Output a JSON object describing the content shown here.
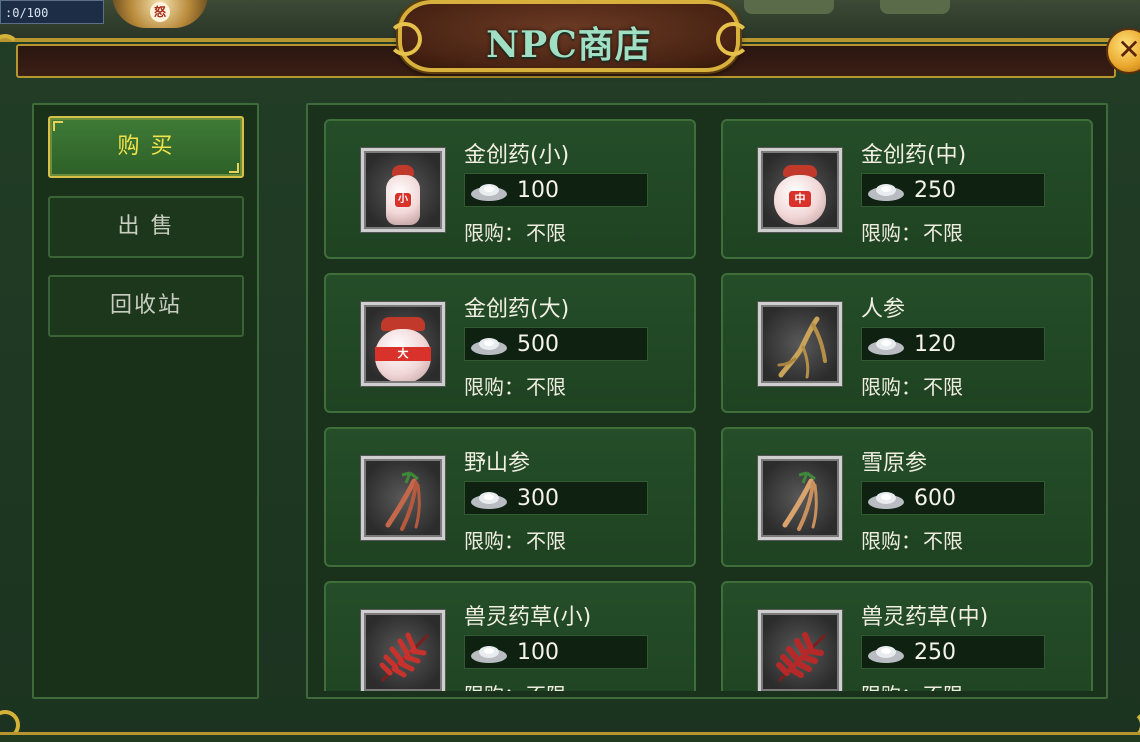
{
  "hud": {
    "counter": ":0/100",
    "emblem_char": "怒"
  },
  "title": "NPC商店",
  "close_symbol": "✕",
  "tabs": [
    {
      "label": "购 买",
      "active": true
    },
    {
      "label": "出 售",
      "active": false
    },
    {
      "label": "回收站",
      "active": false
    }
  ],
  "limit_label": "限购：",
  "goods": [
    {
      "name": "金创药(小)",
      "price": "100",
      "limit": "不限",
      "icon": "medicine-bottle-small-icon",
      "icon_char": "小"
    },
    {
      "name": "金创药(中)",
      "price": "250",
      "limit": "不限",
      "icon": "medicine-bottle-medium-icon",
      "icon_char": "中"
    },
    {
      "name": "金创药(大)",
      "price": "500",
      "limit": "不限",
      "icon": "medicine-bottle-large-icon",
      "icon_char": "大"
    },
    {
      "name": "人参",
      "price": "120",
      "limit": "不限",
      "icon": "ginseng-icon"
    },
    {
      "name": "野山参",
      "price": "300",
      "limit": "不限",
      "icon": "wild-ginseng-icon"
    },
    {
      "name": "雪原参",
      "price": "600",
      "limit": "不限",
      "icon": "snow-ginseng-icon"
    },
    {
      "name": "兽灵药草(小)",
      "price": "100",
      "limit": "不限",
      "icon": "beast-herb-small-icon"
    },
    {
      "name": "兽灵药草(中)",
      "price": "250",
      "limit": "不限",
      "icon": "beast-herb-medium-icon"
    }
  ],
  "colors": {
    "accent_gold": "#d8b03c",
    "active_tab_text": "#f2e34a",
    "title_text": "#9fe0c4",
    "panel_green": "#244d28"
  }
}
